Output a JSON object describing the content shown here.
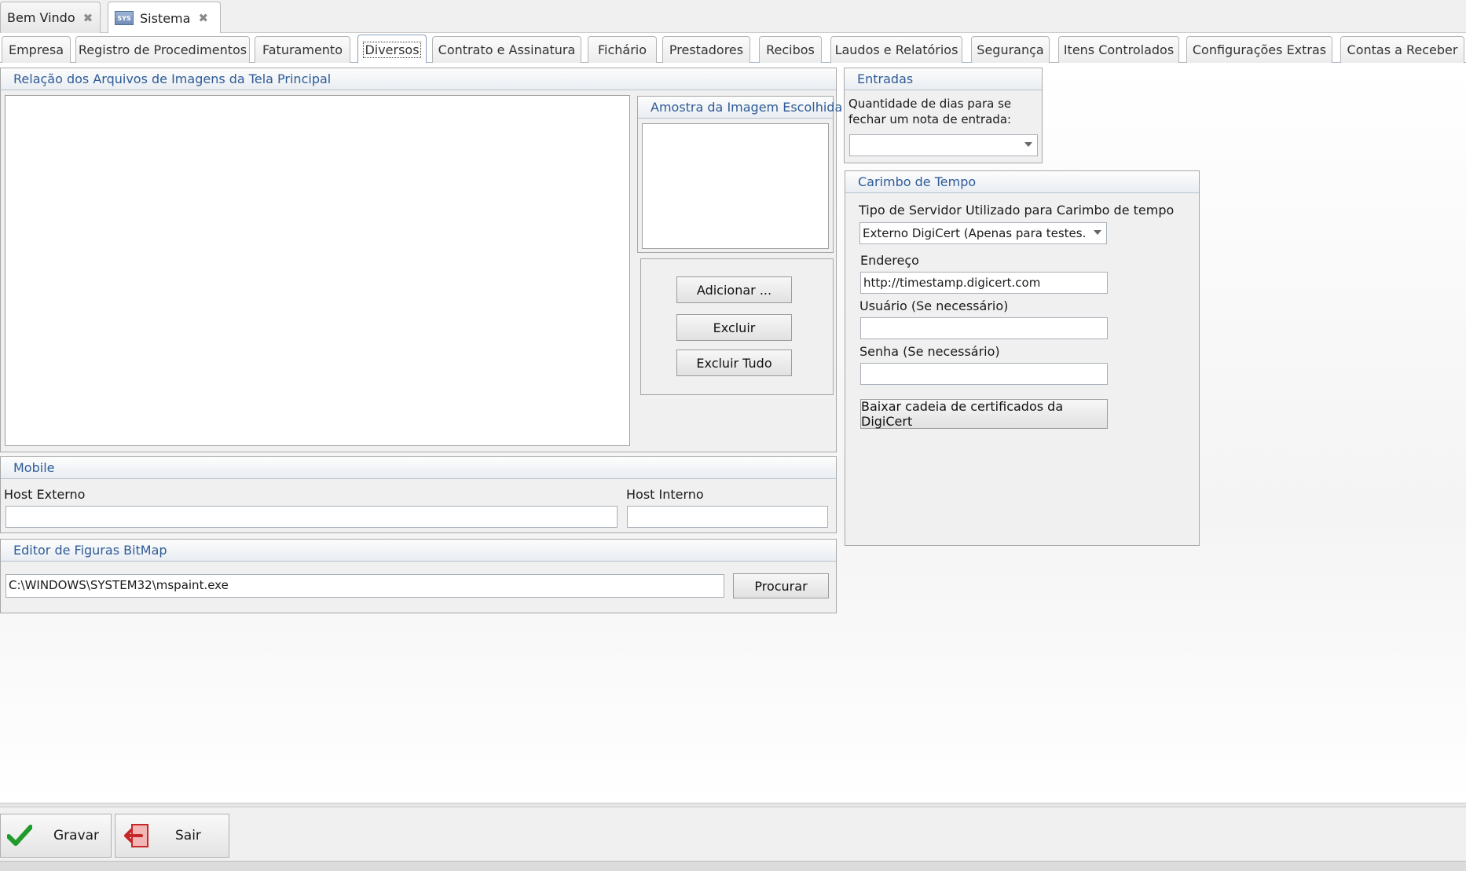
{
  "doc_tabs": [
    {
      "label": "Bem Vindo"
    },
    {
      "label": "Sistema",
      "icon_text": "SYS"
    }
  ],
  "page_tabs": [
    "Empresa",
    "Registro de Procedimentos",
    "Faturamento",
    "Diversos",
    "Contrato e Assinatura",
    "Fichário",
    "Prestadores",
    "Recibos",
    "Laudos e Relatórios",
    "Segurança",
    "Itens Controlados",
    "Configurações Extras",
    "Contas a Receber"
  ],
  "active_page_tab": "Diversos",
  "imagens": {
    "title": "Relação dos Arquivos de Imagens da Tela Principal",
    "preview_title": "Amostra da Imagem Escolhida",
    "add_label": "Adicionar ...",
    "delete_label": "Excluir",
    "delete_all_label": "Excluir Tudo"
  },
  "mobile": {
    "title": "Mobile",
    "host_externo_label": "Host Externo",
    "host_externo_value": "",
    "host_interno_label": "Host Interno",
    "host_interno_value": ""
  },
  "editor": {
    "title": "Editor de Figuras BitMap",
    "path_value": "C:\\WINDOWS\\SYSTEM32\\mspaint.exe",
    "browse_label": "Procurar"
  },
  "entradas": {
    "title": "Entradas",
    "days_label_line1": "Quantidade de dias para se",
    "days_label_line2": "fechar um nota de entrada:",
    "days_value": ""
  },
  "carimbo": {
    "title": "Carimbo de Tempo",
    "server_type_label": "Tipo de Servidor Utilizado para Carimbo de tempo",
    "server_type_value": "Externo DigiCert (Apenas para testes.",
    "address_label": "Endereço",
    "address_value": "http://timestamp.digicert.com",
    "user_label": "Usuário (Se necessário)",
    "user_value": "",
    "password_label": "Senha (Se necessário)",
    "password_value": "",
    "download_label": "Baixar cadeia de certificados da DigiCert"
  },
  "footer": {
    "save_label": "Gravar",
    "exit_label": "Sair"
  }
}
